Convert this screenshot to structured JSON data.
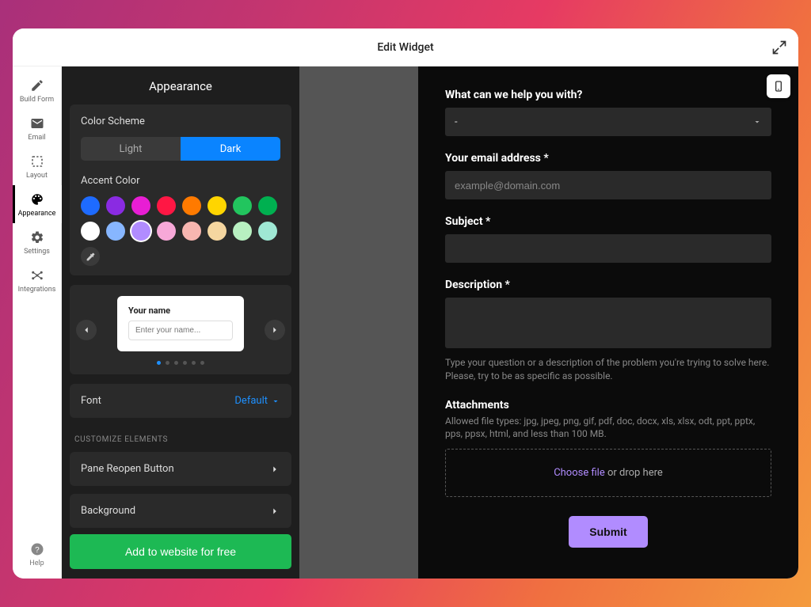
{
  "window": {
    "title": "Edit Widget"
  },
  "nav": {
    "items": [
      {
        "label": "Build Form"
      },
      {
        "label": "Email"
      },
      {
        "label": "Layout"
      },
      {
        "label": "Appearance"
      },
      {
        "label": "Settings"
      },
      {
        "label": "Integrations"
      }
    ],
    "help": "Help"
  },
  "editor": {
    "title": "Appearance",
    "color_scheme": {
      "title": "Color Scheme",
      "light": "Light",
      "dark": "Dark"
    },
    "accent": {
      "title": "Accent Color",
      "colors": [
        "#1e6bff",
        "#8a2be2",
        "#e81ed4",
        "#ff1744",
        "#ff7a00",
        "#ffd500",
        "#22c55e",
        "#00b050",
        "#ffffff",
        "#87b6ff",
        "#b18cff",
        "#f7a8d8",
        "#f7b6b0",
        "#f5d6a0",
        "#b8f0c1",
        "#9fe8d4"
      ]
    },
    "preview_card": {
      "label": "Your name",
      "placeholder": "Enter your name..."
    },
    "font": {
      "label": "Font",
      "value": "Default"
    },
    "customize_section": "CUSTOMIZE ELEMENTS",
    "rows": [
      {
        "label": "Pane Reopen Button"
      },
      {
        "label": "Background"
      }
    ],
    "cta": "Add to website for free"
  },
  "form": {
    "q1": {
      "label": "What can we help you with?",
      "value": "-"
    },
    "email": {
      "label": "Your email address *",
      "placeholder": "example@domain.com"
    },
    "subject": {
      "label": "Subject *"
    },
    "description": {
      "label": "Description *",
      "help": "Type your question or a description of the problem you're trying to solve here. Please, try to be as specific as possible."
    },
    "attachments": {
      "label": "Attachments",
      "desc": "Allowed file types: jpg, jpeg, png, gif, pdf, doc, docx, xls, xlsx, odt, ppt, pptx, pps, ppsx, html, and less than 100 MB.",
      "choose": "Choose file",
      "drop": " or drop here"
    },
    "submit": "Submit"
  }
}
